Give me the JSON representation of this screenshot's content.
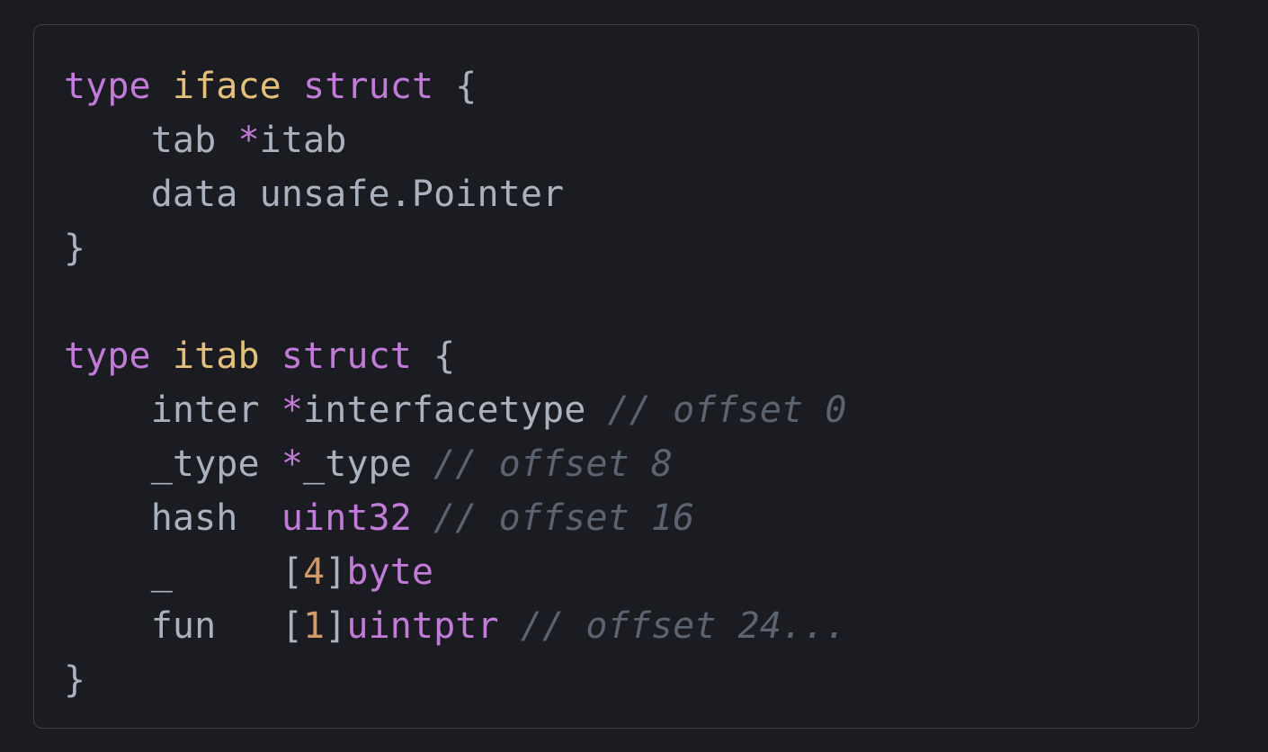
{
  "colors": {
    "keyword": "#c27bd8",
    "typename": "#e5c07b",
    "plain": "#abb2bf",
    "comment": "#5c6370",
    "number": "#d19a66",
    "background": "#1b1c21",
    "border": "#3d3f45"
  },
  "code": {
    "language": "go",
    "lines": [
      [
        {
          "t": "type",
          "c": "kw"
        },
        {
          "t": " ",
          "c": "pl"
        },
        {
          "t": "iface",
          "c": "ty"
        },
        {
          "t": " ",
          "c": "pl"
        },
        {
          "t": "struct",
          "c": "kw"
        },
        {
          "t": " {",
          "c": "pl"
        }
      ],
      [
        {
          "t": "    tab ",
          "c": "pl"
        },
        {
          "t": "*",
          "c": "kw"
        },
        {
          "t": "itab",
          "c": "pl"
        }
      ],
      [
        {
          "t": "    data unsafe.Pointer",
          "c": "pl"
        }
      ],
      [
        {
          "t": "}",
          "c": "pl"
        }
      ],
      [],
      [
        {
          "t": "type",
          "c": "kw"
        },
        {
          "t": " ",
          "c": "pl"
        },
        {
          "t": "itab",
          "c": "ty"
        },
        {
          "t": " ",
          "c": "pl"
        },
        {
          "t": "struct",
          "c": "kw"
        },
        {
          "t": " {",
          "c": "pl"
        }
      ],
      [
        {
          "t": "    inter ",
          "c": "pl"
        },
        {
          "t": "*",
          "c": "kw"
        },
        {
          "t": "interfacetype ",
          "c": "pl"
        },
        {
          "t": "// offset 0",
          "c": "cm"
        }
      ],
      [
        {
          "t": "    _type ",
          "c": "pl"
        },
        {
          "t": "*",
          "c": "kw"
        },
        {
          "t": "_type ",
          "c": "pl"
        },
        {
          "t": "// offset 8",
          "c": "cm"
        }
      ],
      [
        {
          "t": "    hash  ",
          "c": "pl"
        },
        {
          "t": "uint32",
          "c": "kw"
        },
        {
          "t": " ",
          "c": "pl"
        },
        {
          "t": "// offset 16",
          "c": "cm"
        }
      ],
      [
        {
          "t": "    _     [",
          "c": "pl"
        },
        {
          "t": "4",
          "c": "nu"
        },
        {
          "t": "]",
          "c": "pl"
        },
        {
          "t": "byte",
          "c": "kw"
        }
      ],
      [
        {
          "t": "    fun   [",
          "c": "pl"
        },
        {
          "t": "1",
          "c": "nu"
        },
        {
          "t": "]",
          "c": "pl"
        },
        {
          "t": "uintptr",
          "c": "kw"
        },
        {
          "t": " ",
          "c": "pl"
        },
        {
          "t": "// offset 24...",
          "c": "cm"
        }
      ],
      [
        {
          "t": "}",
          "c": "pl"
        }
      ]
    ]
  }
}
